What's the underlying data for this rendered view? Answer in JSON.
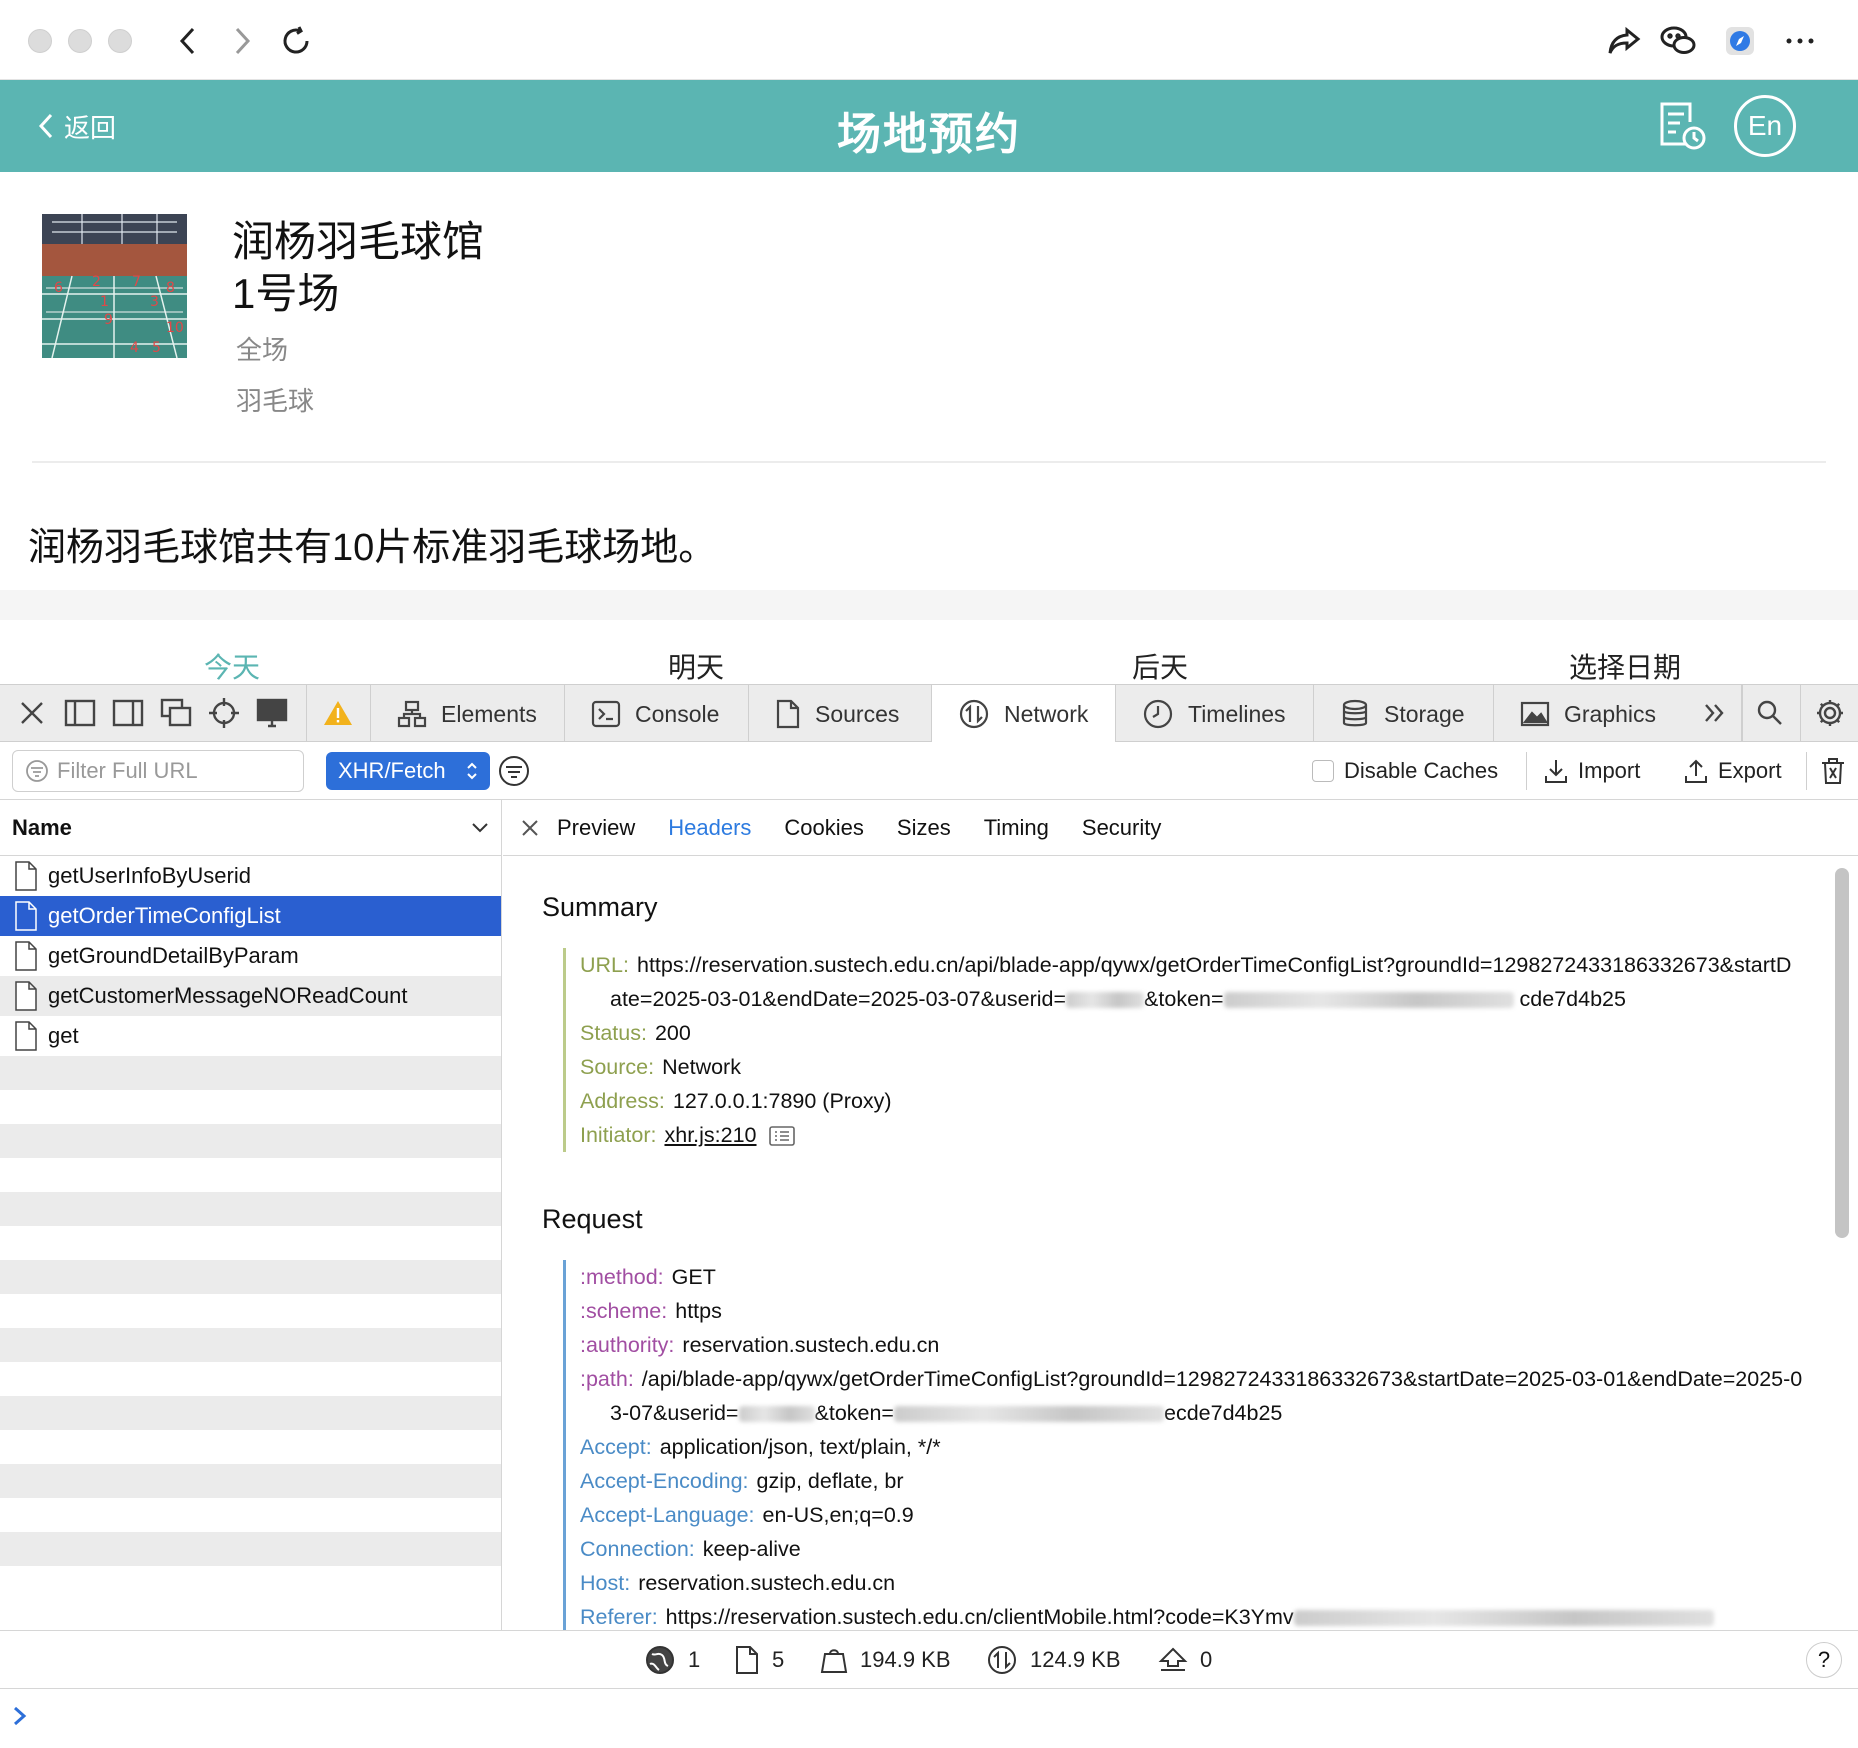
{
  "app": {
    "back_label": "返回",
    "title": "场地预约",
    "lang_label": "En"
  },
  "venue": {
    "name": "润杨羽毛球馆",
    "court": "1号场",
    "area": "全场",
    "sport": "羽毛球",
    "description": "润杨羽毛球馆共有10片标准羽毛球场地。"
  },
  "day_tabs": [
    {
      "label": "今天",
      "active": true
    },
    {
      "label": "明天",
      "active": false
    },
    {
      "label": "后天",
      "active": false
    },
    {
      "label": "选择日期",
      "active": false
    }
  ],
  "devtools": {
    "tabs": [
      "Elements",
      "Console",
      "Sources",
      "Network",
      "Timelines",
      "Storage",
      "Graphics"
    ],
    "active_tab": "Network",
    "filter_placeholder": "Filter Full URL",
    "type_filter": "XHR/Fetch",
    "disable_caches": "Disable Caches",
    "import_label": "Import",
    "export_label": "Export",
    "list_header": "Name",
    "requests": [
      "getUserInfoByUserid",
      "getOrderTimeConfigList",
      "getGroundDetailByParam",
      "getCustomerMessageNOReadCount",
      "get"
    ],
    "selected_request": "getOrderTimeConfigList",
    "detail_tabs": [
      "Preview",
      "Headers",
      "Cookies",
      "Sizes",
      "Timing",
      "Security"
    ],
    "active_detail_tab": "Headers",
    "summary_title": "Summary",
    "summary": {
      "url_key": "URL:",
      "url_value_1": "https://reservation.sustech.edu.cn/api/blade-app/qywx/getOrderTimeConfigList?groundId=1298272433186332673&startDate=2025-03-01&endDate=2025-03-07&userid=",
      "url_value_2": "&token=",
      "url_value_3": "cde7d4b25",
      "status_key": "Status:",
      "status_value": "200",
      "source_key": "Source:",
      "source_value": "Network",
      "address_key": "Address:",
      "address_value": "127.0.0.1:7890 (Proxy)",
      "initiator_key": "Initiator:",
      "initiator_value": "xhr.js:210"
    },
    "request_title": "Request",
    "request": [
      {
        "key": ":method:",
        "value": "GET",
        "kind": "pseudo"
      },
      {
        "key": ":scheme:",
        "value": "https",
        "kind": "pseudo"
      },
      {
        "key": ":authority:",
        "value": "reservation.sustech.edu.cn",
        "kind": "pseudo"
      },
      {
        "key": ":path:",
        "value": "/api/blade-app/qywx/getOrderTimeConfigList?groundId=1298272433186332673&startDate=2025-03-01&endDate=2025-03-07&userid=",
        "kind": "pseudo"
      },
      {
        "key": "Accept:",
        "value": "application/json, text/plain, */*",
        "kind": "header"
      },
      {
        "key": "Accept-Encoding:",
        "value": "gzip, deflate, br",
        "kind": "header"
      },
      {
        "key": "Accept-Language:",
        "value": "en-US,en;q=0.9",
        "kind": "header"
      },
      {
        "key": "Connection:",
        "value": "keep-alive",
        "kind": "header"
      },
      {
        "key": "Host:",
        "value": "reservation.sustech.edu.cn",
        "kind": "header"
      },
      {
        "key": "Referer:",
        "value": "https://reservation.sustech.edu.cn/clientMobile.html?code=K3Ymv",
        "kind": "header"
      }
    ],
    "path_token_label": "&token=",
    "path_tail": "ecde7d4b25",
    "status_bar": {
      "domains": "1",
      "resources": "5",
      "transferred": "194.9 KB",
      "size": "124.9 KB",
      "errors": "0"
    },
    "help_label": "?"
  }
}
